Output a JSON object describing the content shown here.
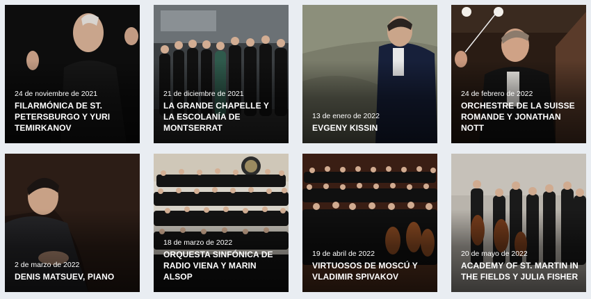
{
  "concerts": [
    {
      "date": "24 de noviembre de 2021",
      "title": "FILARMÓNICA DE ST. PETERSBURGO Y YURI TEMIRKANOV"
    },
    {
      "date": "21 de diciembre de 2021",
      "title": "LA GRANDE CHAPELLE Y LA ESCOLANÍA DE MONTSERRAT"
    },
    {
      "date": "13 de enero de 2022",
      "title": "EVGENY KISSIN"
    },
    {
      "date": "24 de febrero de 2022",
      "title": "ORCHESTRE DE LA SUISSE ROMANDE Y JONATHAN NOTT"
    },
    {
      "date": "2 de marzo de 2022",
      "title": "DENIS MATSUEV, PIANO"
    },
    {
      "date": "18 de marzo de 2022",
      "title": "ORQUESTA SINFÓNICA DE RADIO VIENA Y MARIN ALSOP"
    },
    {
      "date": "19 de abril de 2022",
      "title": "VIRTUOSOS DE MOSCÚ Y VLADIMIR SPIVAKOV"
    },
    {
      "date": "20 de mayo de 2022",
      "title": "ACADEMY OF ST. MARTIN IN THE FIELDS Y JULIA FISHER"
    }
  ]
}
